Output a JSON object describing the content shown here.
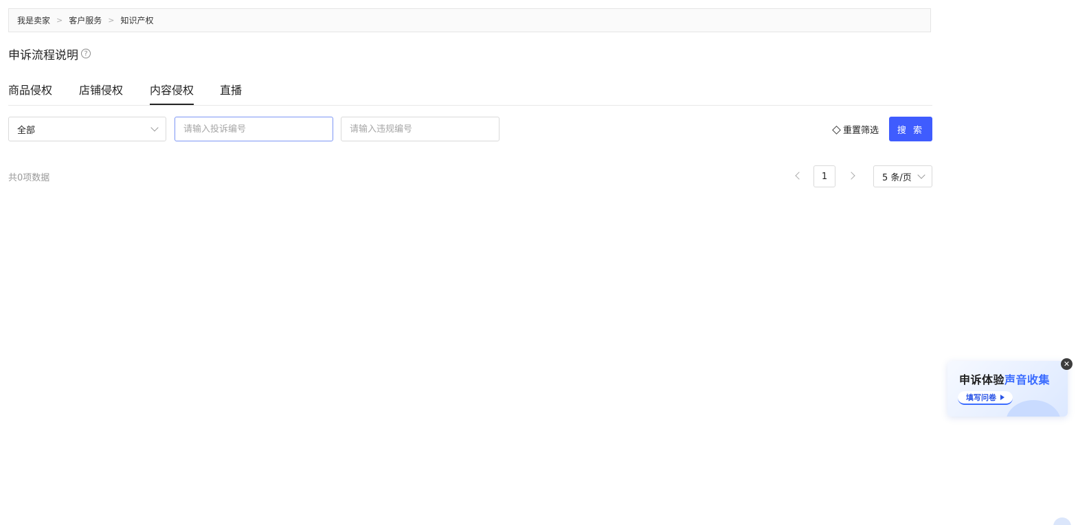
{
  "breadcrumb": {
    "items": [
      "我是卖家",
      "客户服务",
      "知识产权"
    ],
    "separator": ">"
  },
  "page": {
    "title": "申诉流程说明",
    "help_icon": "question-circle-icon"
  },
  "tabs": [
    {
      "label": "商品侵权",
      "active": false
    },
    {
      "label": "店铺侵权",
      "active": false
    },
    {
      "label": "内容侵权",
      "active": true
    },
    {
      "label": "直播",
      "active": false
    }
  ],
  "filters": {
    "status_select": {
      "value": "全部"
    },
    "complaint_no": {
      "placeholder": "请输入投诉编号",
      "value": ""
    },
    "violation_no": {
      "placeholder": "请输入违规编号",
      "value": ""
    },
    "reset_label": "重置筛选",
    "search_label": "搜 索"
  },
  "results": {
    "total_text": "共0项数据"
  },
  "pagination": {
    "current_page": "1",
    "page_size_label": "5 条/页"
  },
  "feedback_widget": {
    "title_plain": "申诉体验",
    "title_highlight": "声音收集",
    "cta_label": "填写问卷",
    "close_glyph": "✕"
  },
  "colors": {
    "primary": "#3f5cfe",
    "focus_border": "#7b95f5",
    "highlight": "#3a6bff"
  }
}
